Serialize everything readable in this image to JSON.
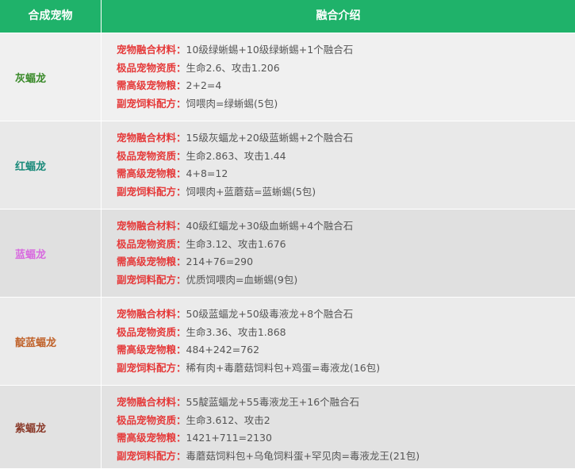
{
  "header": {
    "col1": "合成宠物",
    "col2": "融合介绍"
  },
  "label_colors": {
    "label": "#e53a3a",
    "value": "#555555",
    "header_bg": "#1fb26a"
  },
  "rows": [
    {
      "name": "灰蝠龙",
      "name_color": "#3a8a2a",
      "bg": "#f0f0f0",
      "lines": [
        {
          "label": "宠物融合材料：",
          "value": "10级绿蜥蜴+10级绿蜥蜴+1个融合石"
        },
        {
          "label": "极品宠物资质：",
          "value": "生命2.6、攻击1.206"
        },
        {
          "label": "需高级宠物粮：",
          "value": "2+2=4"
        },
        {
          "label": "副宠饲料配方：",
          "value": "饲喂肉=绿蜥蜴(5包)"
        }
      ]
    },
    {
      "name": "红蝠龙",
      "name_color": "#1a8a7a",
      "bg": "#e9e9e9",
      "lines": [
        {
          "label": "宠物融合材料：",
          "value": "15级灰蝠龙+20级蓝蜥蜴+2个融合石"
        },
        {
          "label": "极品宠物资质：",
          "value": "生命2.863、攻击1.44"
        },
        {
          "label": "需高级宠物粮：",
          "value": "4+8=12"
        },
        {
          "label": "副宠饲料配方：",
          "value": "饲喂肉+蓝蘑菇=蓝蜥蜴(5包)"
        }
      ]
    },
    {
      "name": "蓝蝠龙",
      "name_color": "#d86adf",
      "bg": "#e0e0e0",
      "lines": [
        {
          "label": "宠物融合材料：",
          "value": "40级红蝠龙+30级血蜥蜴+4个融合石"
        },
        {
          "label": "极品宠物资质：",
          "value": "生命3.12、攻击1.676"
        },
        {
          "label": "需高级宠物粮：",
          "value": "214+76=290"
        },
        {
          "label": "副宠饲料配方：",
          "value": "优质饲喂肉=血蜥蜴(9包)"
        }
      ]
    },
    {
      "name": "靛蓝蝠龙",
      "name_color": "#c0622a",
      "bg": "#ebebeb",
      "lines": [
        {
          "label": "宠物融合材料：",
          "value": "50级蓝蝠龙+50级毒液龙+8个融合石"
        },
        {
          "label": "极品宠物资质：",
          "value": "生命3.36、攻击1.868"
        },
        {
          "label": "需高级宠物粮：",
          "value": "484+242=762"
        },
        {
          "label": "副宠饲料配方：",
          "value": "稀有肉+毒蘑菇饲料包+鸡蛋=毒液龙(16包)"
        }
      ]
    },
    {
      "name": "紫蝠龙",
      "name_color": "#8a3a2a",
      "bg": "#e2e2e2",
      "lines": [
        {
          "label": "宠物融合材料：",
          "value": "55靛蓝蝠龙+55毒液龙王+16个融合石"
        },
        {
          "label": "极品宠物资质：",
          "value": "生命3.612、攻击2"
        },
        {
          "label": "需高级宠物粮：",
          "value": "1421+711=2130"
        },
        {
          "label": "副宠饲料配方：",
          "value": "毒蘑菇饲料包+乌龟饲料蛋+罕见肉=毒液龙王(21包)"
        }
      ]
    }
  ]
}
